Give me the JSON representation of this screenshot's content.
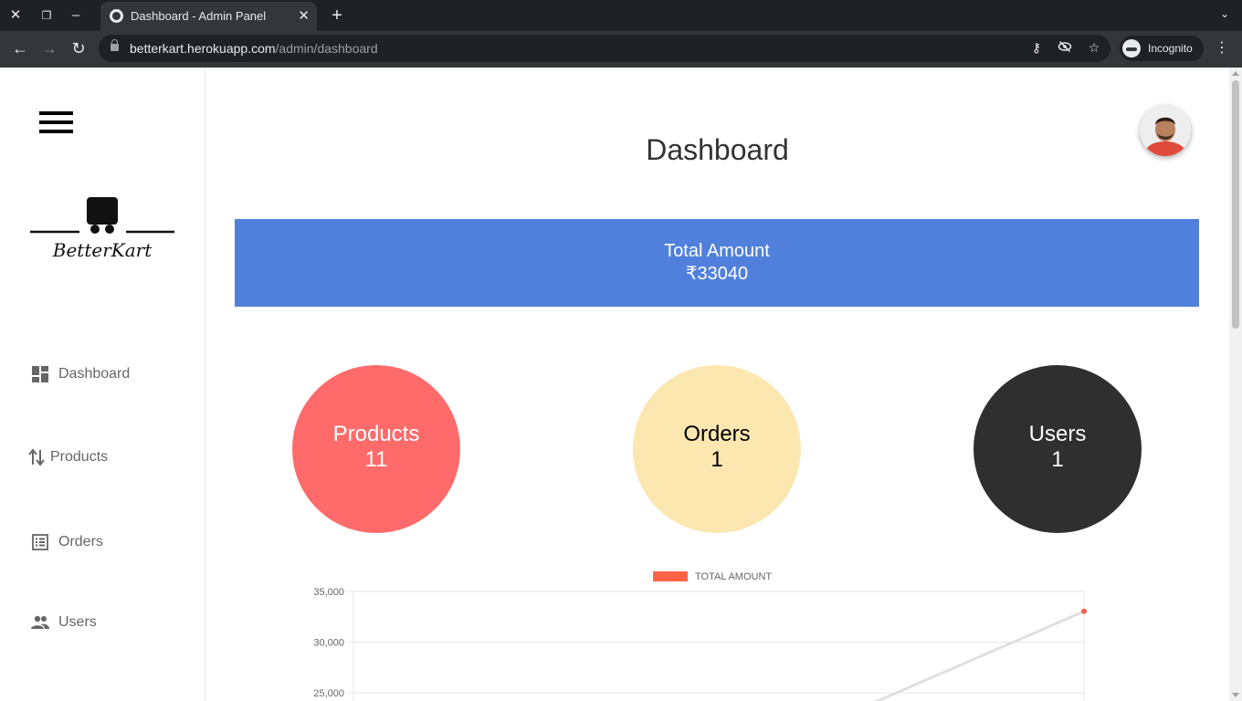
{
  "browser": {
    "tab_title": "Dashboard - Admin Panel",
    "url_domain": "betterkart.herokuapp.com",
    "url_path": "/admin/dashboard",
    "incognito_label": "Incognito"
  },
  "sidebar": {
    "logo_text": "BetterKart",
    "items": [
      {
        "label": "Dashboard",
        "icon": "dashboard-icon"
      },
      {
        "label": "Products",
        "icon": "swap-vertical-icon"
      },
      {
        "label": "Orders",
        "icon": "list-icon"
      },
      {
        "label": "Users",
        "icon": "people-icon"
      }
    ]
  },
  "main": {
    "title": "Dashboard",
    "total": {
      "label": "Total Amount",
      "value": "₹33040"
    },
    "stats": [
      {
        "label": "Products",
        "value": "11"
      },
      {
        "label": "Orders",
        "value": "1"
      },
      {
        "label": "Users",
        "value": "1"
      }
    ]
  },
  "colors": {
    "banner": "#5080dc",
    "products": "#ff6b6b",
    "orders": "#fde7b0",
    "users": "#2f2f2f",
    "series": "#ff6347"
  },
  "chart_data": {
    "type": "line",
    "legend": [
      "TOTAL AMOUNT"
    ],
    "y_ticks": [
      "35,000",
      "30,000",
      "25,000"
    ],
    "ylim_visible": [
      25000,
      35000
    ],
    "series": [
      {
        "name": "TOTAL AMOUNT",
        "points": [
          {
            "y": 33040
          }
        ]
      }
    ]
  }
}
